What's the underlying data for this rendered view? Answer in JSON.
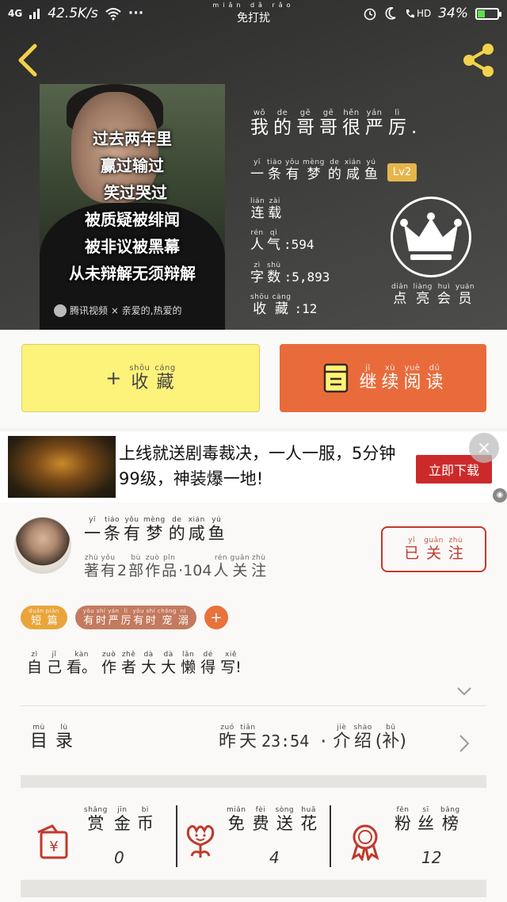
{
  "status_bar": {
    "signal": "4G",
    "speed": "42.5K/s",
    "more": "···",
    "dnd_pinyin": "miǎn dǎ rǎo",
    "dnd": "免打扰",
    "hd": "HD",
    "battery": "34%",
    "battery_level": 0.34
  },
  "book": {
    "cover_lines": [
      "过去两年里",
      "赢过输过",
      "笑过哭过",
      "被质疑被绯闻",
      "被非议被黑幕",
      "从未辩解无须辩解"
    ],
    "cover_watermark": "腾讯视频 × 亲爱的,热爱的",
    "title": [
      {
        "py": "wǒ",
        "ch": "我"
      },
      {
        "py": "de",
        "ch": "的"
      },
      {
        "py": "gē",
        "ch": "哥"
      },
      {
        "py": "gē",
        "ch": "哥"
      },
      {
        "py": "hěn",
        "ch": "很"
      },
      {
        "py": "yán",
        "ch": "严"
      },
      {
        "py": "lì",
        "ch": "厉"
      },
      {
        "py": "",
        "ch": "."
      }
    ],
    "author": [
      {
        "py": "yī",
        "ch": "一"
      },
      {
        "py": "tiáo",
        "ch": "条"
      },
      {
        "py": "yǒu",
        "ch": "有"
      },
      {
        "py": "mèng",
        "ch": "梦"
      },
      {
        "py": "de",
        "ch": "的"
      },
      {
        "py": "xián",
        "ch": "咸"
      },
      {
        "py": "yú",
        "ch": "鱼"
      }
    ],
    "level": "Lv2",
    "status": [
      {
        "py": "lián",
        "ch": "连"
      },
      {
        "py": "zài",
        "ch": "载"
      }
    ],
    "popularity_label": [
      {
        "py": "rén",
        "ch": "人"
      },
      {
        "py": "qì",
        "ch": "气"
      }
    ],
    "popularity": ":594",
    "word_count_label": [
      {
        "py": "zì",
        "ch": "字"
      },
      {
        "py": "shù",
        "ch": "数"
      }
    ],
    "word_count": ":5,893",
    "favorites_label": [
      {
        "py": "shōu",
        "ch": "收"
      },
      {
        "py": "cáng",
        "ch": "藏"
      }
    ],
    "favorites": ":12",
    "vip_label": [
      {
        "py": "diǎn",
        "ch": "点"
      },
      {
        "py": "liàng",
        "ch": "亮"
      },
      {
        "py": "huì",
        "ch": "会"
      },
      {
        "py": "yuán",
        "ch": "员"
      }
    ]
  },
  "actions": {
    "collect_plus": "+",
    "collect": [
      {
        "py": "shōu",
        "ch": "收"
      },
      {
        "py": "cáng",
        "ch": "藏"
      }
    ],
    "read": [
      {
        "py": "jì",
        "ch": "继"
      },
      {
        "py": "xù",
        "ch": "续"
      },
      {
        "py": "yuè",
        "ch": "阅"
      },
      {
        "py": "dú",
        "ch": "读"
      }
    ]
  },
  "ad": {
    "text": "上线就送剧毒裁决，一人一服，5分钟99级，神装爆一地!",
    "cta": "立即下载",
    "close": "×",
    "mark": "◉"
  },
  "author_card": {
    "name": [
      {
        "py": "yī",
        "ch": "一"
      },
      {
        "py": "tiáo",
        "ch": "条"
      },
      {
        "py": "yǒu",
        "ch": "有"
      },
      {
        "py": "mèng",
        "ch": "梦"
      },
      {
        "py": "de",
        "ch": "的"
      },
      {
        "py": "xián",
        "ch": "咸"
      },
      {
        "py": "yú",
        "ch": "鱼"
      }
    ],
    "stats": [
      {
        "py": "zhù",
        "ch": "著"
      },
      {
        "py": "yǒu",
        "ch": "有"
      },
      {
        "py": "",
        "ch": "2"
      },
      {
        "py": "bù",
        "ch": "部"
      },
      {
        "py": "zuò",
        "ch": "作"
      },
      {
        "py": "pǐn",
        "ch": "品"
      },
      {
        "py": "",
        "ch": "·104"
      },
      {
        "py": "rén",
        "ch": "人"
      },
      {
        "py": "guān",
        "ch": "关"
      },
      {
        "py": "zhù",
        "ch": "注"
      }
    ],
    "follow": [
      {
        "py": "yǐ",
        "ch": "已"
      },
      {
        "py": "guān",
        "ch": "关"
      },
      {
        "py": "zhù",
        "ch": "注"
      }
    ],
    "tag_short": [
      {
        "py": "duǎn",
        "ch": "短"
      },
      {
        "py": "piān",
        "ch": "篇"
      }
    ],
    "tag_theme": [
      {
        "py": "yǒu",
        "ch": "有"
      },
      {
        "py": "shí",
        "ch": "时"
      },
      {
        "py": "yán",
        "ch": "严"
      },
      {
        "py": "lì",
        "ch": "厉"
      },
      {
        "py": "yǒu",
        "ch": "有"
      },
      {
        "py": "shí",
        "ch": "时"
      },
      {
        "py": "chǒng",
        "ch": "宠"
      },
      {
        "py": "nì",
        "ch": "溺"
      }
    ],
    "tag_add": "+",
    "intro": [
      {
        "py": "zì",
        "ch": "自"
      },
      {
        "py": "jǐ",
        "ch": "己"
      },
      {
        "py": "kàn",
        "ch": "看。"
      },
      {
        "py": "zuò",
        "ch": "作"
      },
      {
        "py": "zhě",
        "ch": "者"
      },
      {
        "py": "dà",
        "ch": "大"
      },
      {
        "py": "dà",
        "ch": "大"
      },
      {
        "py": "lǎn",
        "ch": "懒"
      },
      {
        "py": "dé",
        "ch": "得"
      },
      {
        "py": "xiě",
        "ch": "写!"
      }
    ],
    "toc": [
      {
        "py": "mù",
        "ch": "目"
      },
      {
        "py": "lù",
        "ch": "录"
      }
    ],
    "update": [
      {
        "py": "zuó",
        "ch": "昨"
      },
      {
        "py": "tiān",
        "ch": "天"
      }
    ],
    "update_time": "23:54 ·",
    "intro_tab": [
      {
        "py": "jiè",
        "ch": "介"
      },
      {
        "py": "shào",
        "ch": "绍"
      },
      {
        "py": "bǔ",
        "ch": "(补)"
      }
    ]
  },
  "rewards": [
    {
      "label": [
        {
          "py": "shǎng",
          "ch": "赏"
        },
        {
          "py": "jīn",
          "ch": "金"
        },
        {
          "py": "bì",
          "ch": "币"
        }
      ],
      "count": "0",
      "icon": "red-envelope-icon"
    },
    {
      "label": [
        {
          "py": "miǎn",
          "ch": "免"
        },
        {
          "py": "fèi",
          "ch": "费"
        },
        {
          "py": "sòng",
          "ch": "送"
        },
        {
          "py": "huā",
          "ch": "花"
        }
      ],
      "count": "4",
      "icon": "flower-icon"
    },
    {
      "label": [
        {
          "py": "fěn",
          "ch": "粉"
        },
        {
          "py": "sī",
          "ch": "丝"
        },
        {
          "py": "bǎng",
          "ch": "榜"
        }
      ],
      "count": "12",
      "icon": "medal-icon"
    }
  ],
  "colors": {
    "accent_orange": "#e96b3c",
    "collect_yellow": "#fdf27a",
    "follow_red": "#c0392b",
    "share_yellow": "#f2d24a",
    "battery_green": "#5be04a"
  }
}
